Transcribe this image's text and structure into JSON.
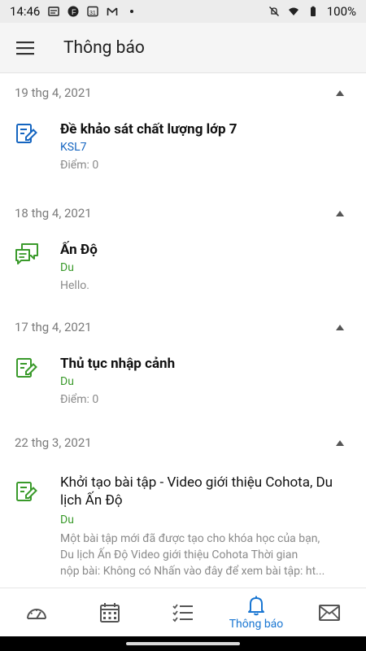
{
  "status": {
    "time": "14:46",
    "battery": "100%"
  },
  "header": {
    "title": "Thông báo"
  },
  "groups": [
    {
      "date": "19 thg 4, 2021",
      "item": {
        "title": "Đề khảo sát chất lượng lớp 7",
        "sub": "KSL7",
        "sub_color": "#1565c0",
        "meta": "Điểm: 0",
        "icon": "assignment-edit-icon",
        "icon_color": "#1565c0"
      }
    },
    {
      "date": "18 thg 4, 2021",
      "item": {
        "title": "Ấn Độ",
        "sub": "Du",
        "sub_color": "#3a9a2b",
        "meta": "Hello.",
        "icon": "chat-bubbles-icon",
        "icon_color": "#3a9a2b"
      }
    },
    {
      "date": "17 thg 4, 2021",
      "item": {
        "title": "Thủ tục nhập cảnh",
        "sub": "Du",
        "sub_color": "#3a9a2b",
        "meta": "Điểm: 0",
        "icon": "assignment-edit-icon",
        "icon_color": "#3a9a2b"
      }
    },
    {
      "date": "22 thg 3, 2021",
      "item": {
        "title": "Khởi tạo bài tập - Video giới thiệu Cohota, Du lịch Ấn Độ",
        "sub": "Du",
        "sub_color": "#3a9a2b",
        "desc_lines": [
          "Một bài tập mới đã được tạo cho khóa học của bạn,",
          "Du lịch Ấn Độ Video giới thiệu Cohota Thời gian",
          "nộp bài: Không có Nhấn vào đây để xem bài tập: ht..."
        ],
        "icon": "assignment-edit-icon",
        "icon_color": "#3a9a2b"
      }
    }
  ],
  "bottom_nav": {
    "items": [
      {
        "icon": "dashboard-gauge-icon"
      },
      {
        "icon": "calendar-icon"
      },
      {
        "icon": "checklist-icon"
      },
      {
        "icon": "bell-icon",
        "label": "Thông báo",
        "active": true
      },
      {
        "icon": "mail-icon"
      }
    ],
    "active_color": "#1976d2",
    "inactive_color": "#555555"
  }
}
